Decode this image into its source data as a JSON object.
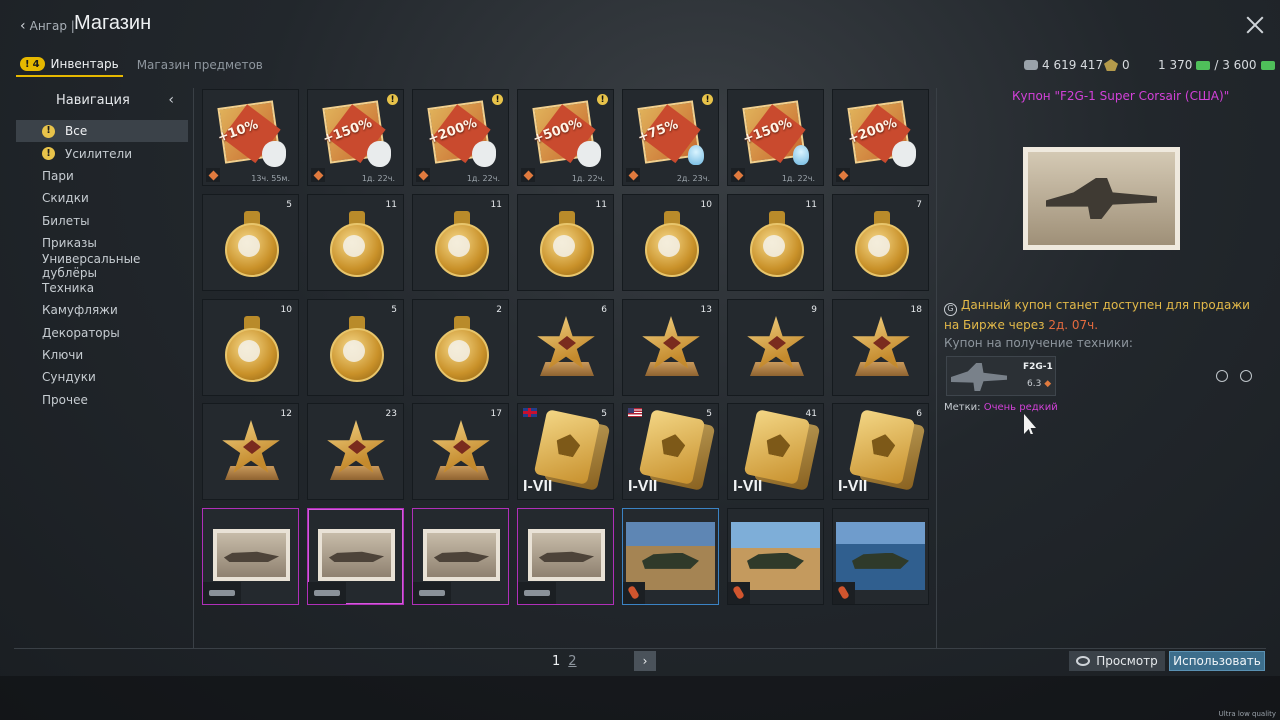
{
  "header": {
    "back_label": "Ангар |",
    "title": "Магазин"
  },
  "tabs": [
    {
      "label": "Инвентарь",
      "badge": "4",
      "active": true
    },
    {
      "label": "Магазин предметов",
      "active": false
    }
  ],
  "currency": {
    "silver": "4 619 417",
    "eagles": "0",
    "gold": "1 370",
    "gold_cap": "/ 3 600"
  },
  "nav": {
    "title": "Навигация",
    "items": [
      {
        "label": "Все",
        "alert": true,
        "selected": true
      },
      {
        "label": "Усилители",
        "alert": true
      },
      {
        "label": "Пари"
      },
      {
        "label": "Скидки"
      },
      {
        "label": "Билеты"
      },
      {
        "label": "Приказы"
      },
      {
        "label": "Универсальные дублёры"
      },
      {
        "label": "Техника"
      },
      {
        "label": "Камуфляжи"
      },
      {
        "label": "Декораторы"
      },
      {
        "label": "Ключи"
      },
      {
        "label": "Сундуки"
      },
      {
        "label": "Прочее"
      }
    ]
  },
  "grid": {
    "row1": [
      {
        "percent": "+10%",
        "timer": "13ч. 55м.",
        "alert": false,
        "bulb": false
      },
      {
        "percent": "+150%",
        "timer": "1д. 22ч.",
        "alert": true,
        "bulb": false
      },
      {
        "percent": "+200%",
        "timer": "1д. 22ч.",
        "alert": true,
        "bulb": false
      },
      {
        "percent": "+500%",
        "timer": "1д. 22ч.",
        "alert": true,
        "bulb": false
      },
      {
        "percent": "+75%",
        "timer": "2д. 23ч.",
        "alert": true,
        "bulb": true
      },
      {
        "percent": "+150%",
        "timer": "1д. 22ч.",
        "alert": false,
        "bulb": true
      },
      {
        "percent": "+200%",
        "timer": "",
        "alert": false,
        "bulb": false
      }
    ],
    "row2": [
      "5",
      "11",
      "11",
      "11",
      "10",
      "11",
      "7"
    ],
    "row3": [
      {
        "count": "10",
        "type": "medal"
      },
      {
        "count": "5",
        "type": "medal"
      },
      {
        "count": "2",
        "type": "medal"
      },
      {
        "count": "6",
        "type": "star"
      },
      {
        "count": "13",
        "type": "star"
      },
      {
        "count": "9",
        "type": "star"
      },
      {
        "count": "18",
        "type": "star"
      }
    ],
    "row4": [
      {
        "count": "12",
        "type": "star"
      },
      {
        "count": "23",
        "type": "star"
      },
      {
        "count": "17",
        "type": "star"
      },
      {
        "count": "5",
        "type": "card",
        "tier": "I-VII",
        "flag": "uk"
      },
      {
        "count": "5",
        "type": "card",
        "tier": "I-VII",
        "flag": "us"
      },
      {
        "count": "41",
        "type": "card",
        "tier": "I-VII",
        "flag": ""
      },
      {
        "count": "6",
        "type": "card",
        "tier": "I-VII",
        "flag": ""
      }
    ],
    "row5": [
      {
        "kind": "photo",
        "rarity": "rare"
      },
      {
        "kind": "photo",
        "rarity": "rare",
        "selected": true
      },
      {
        "kind": "photo",
        "rarity": "rare"
      },
      {
        "kind": "photo",
        "rarity": "rare"
      },
      {
        "kind": "scene",
        "rarity": "epic"
      },
      {
        "kind": "scene",
        "rarity": "none"
      },
      {
        "kind": "scene",
        "rarity": "none"
      }
    ]
  },
  "detail": {
    "title": "Купон \"F2G-1 Super Corsair (США)\"",
    "info_prefix": "Данный купон станет доступен для продажи на Бирже через ",
    "info_time": "2д. 07ч.",
    "coupon_label": "Купон на получение техники:",
    "vehicle_name": "F2G-1",
    "vehicle_br": "6.3",
    "tags_label": "Метки:",
    "tags_value": "Очень редкий",
    "accent_color": "#d241d8"
  },
  "pager": {
    "current": "1",
    "next": "2"
  },
  "buttons": {
    "preview": "Просмотр",
    "use": "Использовать"
  },
  "footer": {
    "quality": "Ultra low quality"
  }
}
